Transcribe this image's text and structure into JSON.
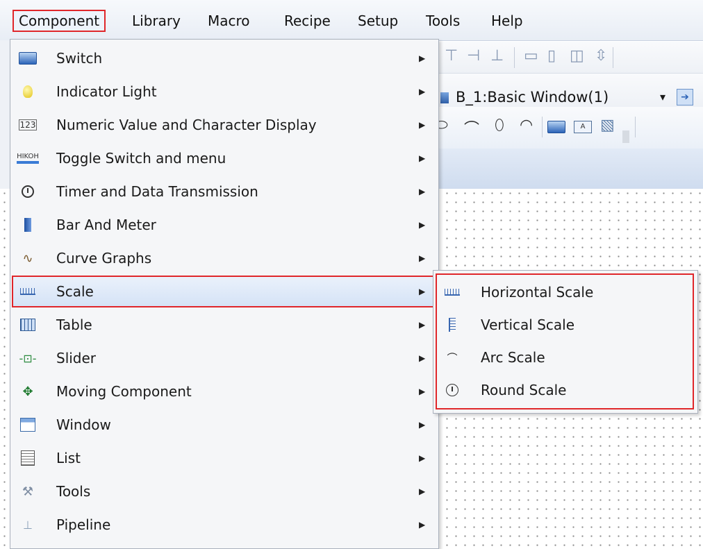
{
  "menubar": {
    "items": [
      {
        "label": "Component",
        "active": true
      },
      {
        "label": "Library"
      },
      {
        "label": "Macro"
      },
      {
        "label": "Recipe"
      },
      {
        "label": "Setup"
      },
      {
        "label": "Tools"
      },
      {
        "label": "Help"
      }
    ]
  },
  "toolbar": {
    "window_select": "B_1:Basic Window(1)"
  },
  "component_menu": {
    "items": [
      {
        "label": "Switch",
        "icon": "switch-icon"
      },
      {
        "label": "Indicator Light",
        "icon": "bulb-icon"
      },
      {
        "label": "Numeric Value and Character Display",
        "icon": "numeric-display-icon",
        "icon_text": "123"
      },
      {
        "label": "Toggle Switch and menu",
        "icon": "toggle-switch-icon",
        "icon_text": "HIKOH"
      },
      {
        "label": "Timer and Data Transmission",
        "icon": "clock-icon"
      },
      {
        "label": "Bar And Meter",
        "icon": "bar-meter-icon"
      },
      {
        "label": "Curve Graphs",
        "icon": "curve-graph-icon"
      },
      {
        "label": "Scale",
        "icon": "ruler-icon",
        "highlighted": true
      },
      {
        "label": "Table",
        "icon": "table-icon"
      },
      {
        "label": "Slider",
        "icon": "slider-icon"
      },
      {
        "label": "Moving Component",
        "icon": "move-arrows-icon"
      },
      {
        "label": "Window",
        "icon": "window-icon"
      },
      {
        "label": "List",
        "icon": "list-icon"
      },
      {
        "label": "Tools",
        "icon": "tools-icon"
      },
      {
        "label": "Pipeline",
        "icon": "pipeline-icon"
      }
    ]
  },
  "scale_submenu": {
    "items": [
      {
        "label": "Horizontal Scale",
        "icon": "horizontal-scale-icon"
      },
      {
        "label": "Vertical Scale",
        "icon": "vertical-scale-icon"
      },
      {
        "label": "Arc Scale",
        "icon": "arc-scale-icon"
      },
      {
        "label": "Round Scale",
        "icon": "round-scale-icon"
      }
    ]
  },
  "colors": {
    "highlight_border": "#e0262a",
    "menu_background": "#f5f6f8",
    "hover_background": "#d5e3f6"
  }
}
